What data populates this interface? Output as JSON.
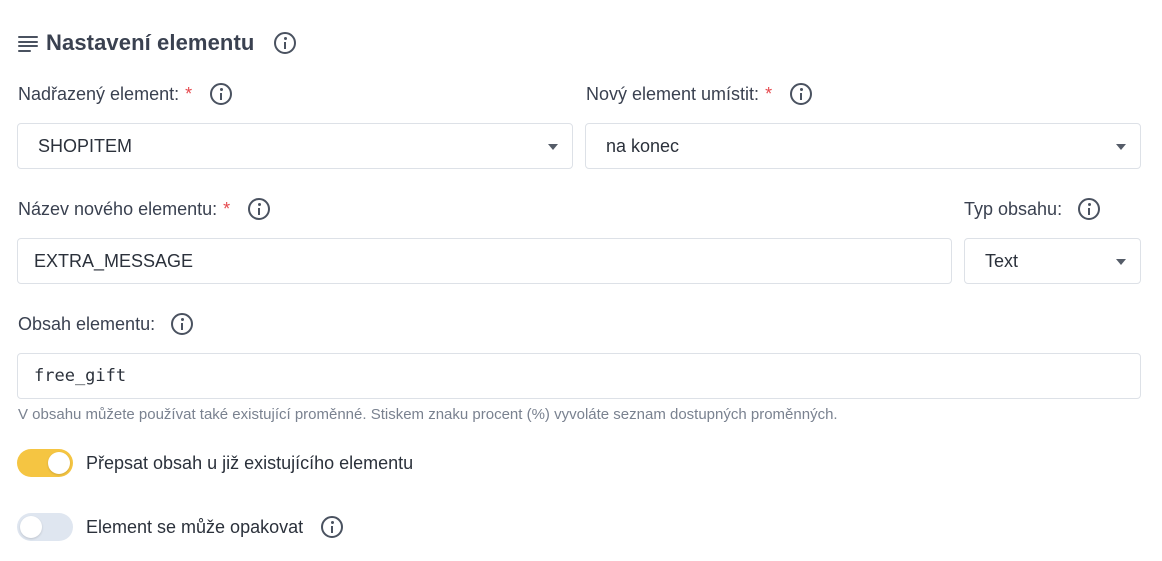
{
  "section": {
    "title": "Nastavení elementu"
  },
  "parent_element": {
    "label": "Nadřazený element:",
    "required_mark": "*",
    "value": "SHOPITEM"
  },
  "placement": {
    "label": "Nový element umístit:",
    "required_mark": "*",
    "value": "na konec"
  },
  "element_name": {
    "label": "Název nového elementu:",
    "required_mark": "*",
    "value": "EXTRA_MESSAGE"
  },
  "content_type": {
    "label": "Typ obsahu:",
    "value": "Text"
  },
  "content": {
    "label": "Obsah elementu:",
    "value": "free_gift",
    "hint": "V obsahu můžete používat také existující proměnné. Stiskem znaku procent (%) vyvoláte seznam dostupných proměnných."
  },
  "toggles": {
    "overwrite": {
      "label": "Přepsat obsah u již existujícího elementu",
      "state": "on"
    },
    "repeat": {
      "label": "Element se může opakovat",
      "state": "off"
    }
  },
  "colors": {
    "toggle_on": "#f5c542",
    "toggle_off": "#dfe6f0",
    "required": "#e5484d"
  }
}
